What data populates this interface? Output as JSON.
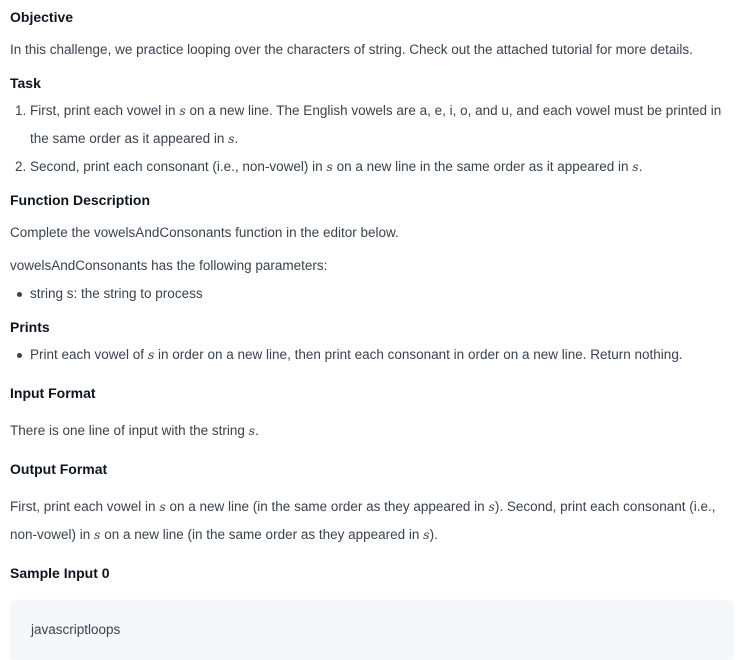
{
  "objective": {
    "heading": "Objective",
    "text": "In this challenge, we practice looping over the characters of string. Check out the attached tutorial for more details."
  },
  "task": {
    "heading": "Task",
    "items": [
      {
        "number": "1.",
        "line1_a": "First, print each vowel in ",
        "line1_var": "s",
        "line1_b": " on a new line. The English vowels are a, e, i, o, and u, and each vowel must be printed in",
        "line2_a": "the same order as it appeared in ",
        "line2_var": "s",
        "line2_b": "."
      },
      {
        "number": "2.",
        "line1_a": "Second, print each consonant (i.e., non-vowel) in ",
        "line1_var": "s",
        "line1_b": " on a new line in the same order as it appeared in ",
        "line1_var2": "s",
        "line1_c": "."
      }
    ]
  },
  "function_description": {
    "heading": "Function Description",
    "text1": "Complete the vowelsAndConsonants function in the editor below.",
    "text2": "vowelsAndConsonants has the following parameters:",
    "params": [
      "string s: the string to process"
    ]
  },
  "prints": {
    "heading": "Prints",
    "item_a": "Print each vowel of ",
    "item_var": "s",
    "item_b": " in order on a new line, then print each consonant in order on a new line. Return nothing."
  },
  "input_format": {
    "heading": "Input Format",
    "text_a": "There is one line of input with the string ",
    "text_var": "s",
    "text_b": "."
  },
  "output_format": {
    "heading": "Output Format",
    "line1_a": "First, print each vowel in ",
    "line1_var": "s",
    "line1_b": " on a new line (in the same order as they appeared in ",
    "line1_var2": "s",
    "line1_c": "). Second, print each consonant (i.e.,",
    "line2_a": "non-vowel) in ",
    "line2_var": "s",
    "line2_b": " on a new line (in the same order as they appeared in ",
    "line2_var2": "s",
    "line2_c": ")."
  },
  "sample_input": {
    "heading": "Sample Input 0",
    "code": "javascriptloops"
  }
}
